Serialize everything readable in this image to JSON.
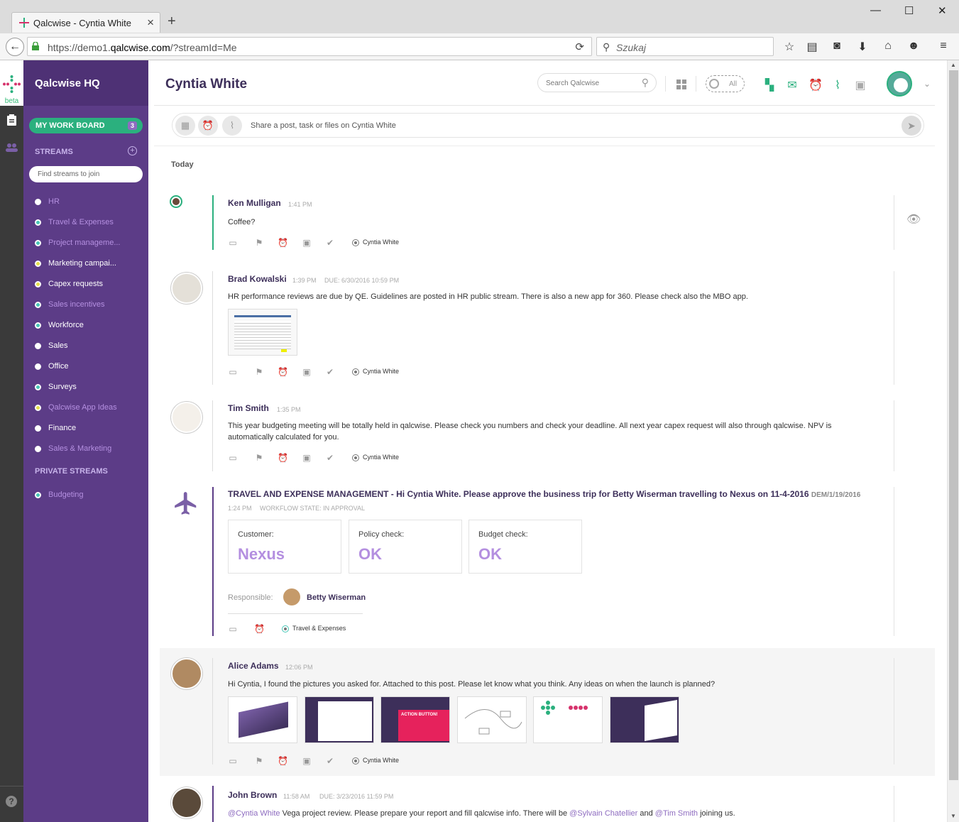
{
  "browser": {
    "tab_title": "Qalcwise - Cyntia White",
    "url_prefix": "https://demo1.",
    "url_domain": "qalcwise.com",
    "url_suffix": "/?streamId=Me",
    "search_placeholder": "Szukaj"
  },
  "app": {
    "beta_label": "beta",
    "org_name": "Qalcwise HQ",
    "workboard_label": "MY WORK BOARD",
    "workboard_count": "3",
    "streams_header": "STREAMS",
    "find_streams_placeholder": "Find streams to join",
    "streams": [
      {
        "label": "HR",
        "color": "#b48fe0"
      },
      {
        "label": "Travel & Expenses",
        "color": "#b48fe0"
      },
      {
        "label": "Project manageme...",
        "color": "#b48fe0"
      },
      {
        "label": "Marketing campai...",
        "color": "#ffffff"
      },
      {
        "label": "Capex requests",
        "color": "#ffffff"
      },
      {
        "label": "Sales incentives",
        "color": "#b48fe0"
      },
      {
        "label": "Workforce",
        "color": "#ffffff"
      },
      {
        "label": "Sales",
        "color": "#ffffff"
      },
      {
        "label": "Office",
        "color": "#ffffff"
      },
      {
        "label": "Surveys",
        "color": "#ffffff"
      },
      {
        "label": "Qalcwise App Ideas",
        "color": "#b48fe0"
      },
      {
        "label": "Finance",
        "color": "#ffffff"
      },
      {
        "label": "Sales & Marketing",
        "color": "#b48fe0"
      }
    ],
    "stream_dot_colors": [
      "#ffffff",
      "#46c6b6",
      "#46c6b6",
      "#e6e04a",
      "#e6e04a",
      "#46c6b6",
      "#46c6b6",
      "#ffffff",
      "#ffffff",
      "#46c6b6",
      "#e6e04a",
      "#ffffff",
      "#ffffff"
    ],
    "private_header": "PRIVATE STREAMS",
    "private_streams": [
      {
        "label": "Budgeting",
        "color": "#b48fe0"
      }
    ]
  },
  "header": {
    "title": "Cyntia White",
    "search_placeholder": "Search Qalcwise",
    "filter_label": "All"
  },
  "composer": {
    "placeholder": "Share a post, task or files on Cyntia White"
  },
  "feed": {
    "day_label": "Today",
    "posts": [
      {
        "author": "Ken Mulligan",
        "time": "1:41 PM",
        "text": "Coffee?",
        "stream": "Cyntia White"
      },
      {
        "author": "Brad Kowalski",
        "time": "1:39 PM",
        "due": "DUE: 6/30/2016 10:59 PM",
        "text": "HR performance reviews are due by QE. Guidelines are posted in HR public stream. There is also a new app for 360. Please check also the MBO app.",
        "stream": "Cyntia White"
      },
      {
        "author": "Tim Smith",
        "time": "1:35 PM",
        "text": "This year budgeting meeting will be totally held in qalcwise. Please check you numbers and check your deadline. All next year capex request will also through qalcwise. NPV is automatically calculated for you.",
        "stream": "Cyntia White"
      },
      {
        "title": "TRAVEL AND EXPENSE MANAGEMENT - Hi Cyntia White. Please approve the business trip for Betty Wiserman travelling to Nexus on 11-4-2016",
        "code": "DEM/1/19/2016",
        "time": "1:24 PM",
        "state": "WORKFLOW STATE: IN APPROVAL",
        "cards": [
          {
            "label": "Customer:",
            "value": "Nexus"
          },
          {
            "label": "Policy check:",
            "value": "OK"
          },
          {
            "label": "Budget check:",
            "value": "OK"
          }
        ],
        "responsible_label": "Responsible:",
        "responsible_name": "Betty Wiserman",
        "stream": "Travel & Expenses"
      },
      {
        "author": "Alice Adams",
        "time": "12:06 PM",
        "text": "Hi Cyntia, I found the pictures you asked for. Attached to this post. Please let know what you think. Any ideas on when the launch is planned?",
        "stream": "Cyntia White",
        "thumb_caption": "ACTION BUTTON!"
      },
      {
        "author": "John Brown",
        "time": "11:58 AM",
        "due": "DUE: 3/23/2016 11:59 PM",
        "mention1": "@Cyntia White",
        "text1": " Vega project review. Please prepare your report and fill qalcwise info. There will be ",
        "mention2": "@Sylvain Chatellier",
        "text2": " and ",
        "mention3": "@Tim Smith",
        "text3": " joining us."
      }
    ]
  }
}
